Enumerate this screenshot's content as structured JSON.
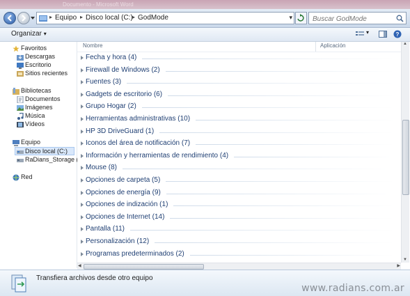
{
  "titlebar": {
    "ghost_text": "Documento - Microsoft Word"
  },
  "address": {
    "crumbs": [
      "Equipo",
      "Disco local (C:)",
      "GodMode"
    ]
  },
  "search": {
    "placeholder": "Buscar GodMode"
  },
  "toolbar": {
    "organize_label": "Organizar"
  },
  "sidebar": {
    "favorites": {
      "label": "Favoritos",
      "items": [
        "Descargas",
        "Escritorio",
        "Sitios recientes"
      ]
    },
    "libraries": {
      "label": "Bibliotecas",
      "items": [
        "Documentos",
        "Imágenes",
        "Música",
        "Vídeos"
      ]
    },
    "computer": {
      "label": "Equipo",
      "items": [
        "Disco local (C:)",
        "RaDians_Storage (E:)"
      ]
    },
    "network": {
      "label": "Red"
    }
  },
  "columns": {
    "name": "Nombre",
    "app": "Aplicación"
  },
  "groups": [
    "Fecha y hora (4)",
    "Firewall de Windows (2)",
    "Fuentes (3)",
    "Gadgets de escritorio (6)",
    "Grupo Hogar (2)",
    "Herramientas administrativas (10)",
    "HP 3D DriveGuard (1)",
    "Iconos del área de notificación (7)",
    "Información y herramientas de rendimiento (4)",
    "Mouse (8)",
    "Opciones de carpeta (5)",
    "Opciones de energía (9)",
    "Opciones de indización (1)",
    "Opciones de Internet (14)",
    "Pantalla (11)",
    "Personalización (12)",
    "Programas predeterminados (2)"
  ],
  "details": {
    "text": "Transfiera archivos desde otro equipo"
  },
  "watermark": "www.radians.com.ar",
  "colors": {
    "accent": "#1f3f73",
    "selection": "#d9e8fb"
  }
}
